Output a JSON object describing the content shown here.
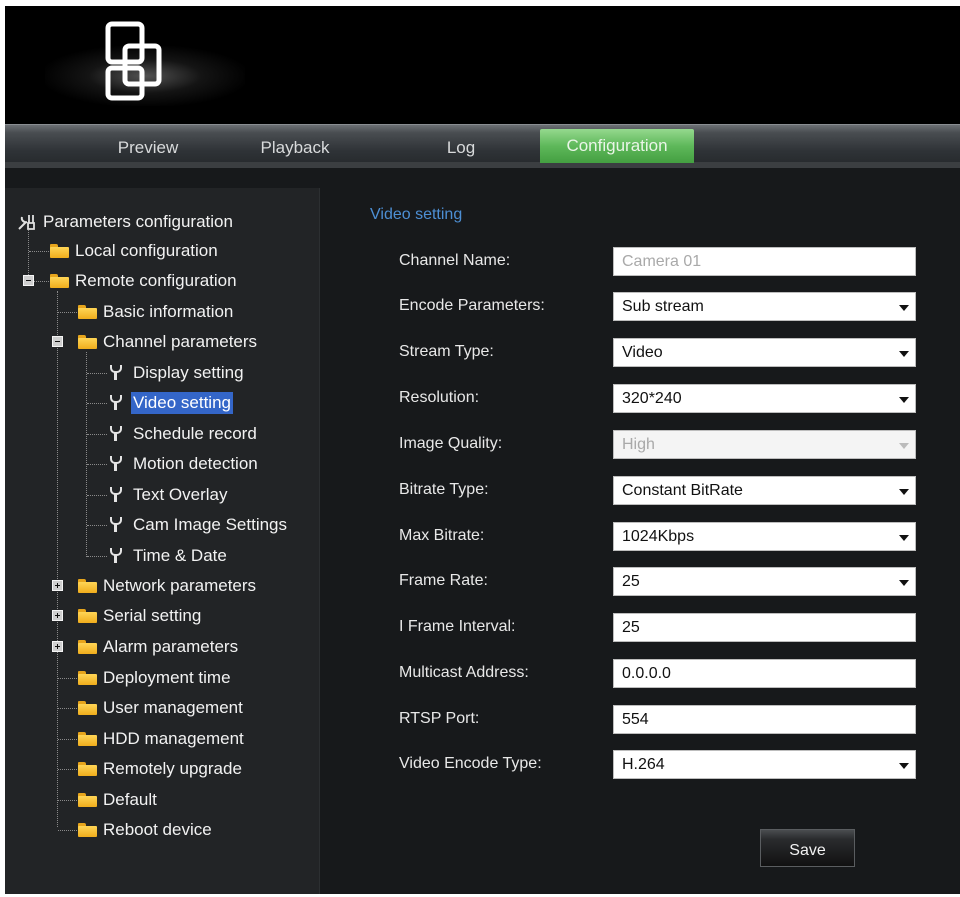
{
  "nav": {
    "tabs": [
      {
        "label": "Preview"
      },
      {
        "label": "Playback"
      },
      {
        "label": "Log"
      },
      {
        "label": "Configuration"
      }
    ],
    "active_tab": "Configuration",
    "active_color": "#5eb85a"
  },
  "sidebar": {
    "root": "Parameters configuration",
    "items": {
      "local": "Local configuration",
      "remote": "Remote configuration",
      "basic": "Basic information",
      "channel": "Channel parameters",
      "display": "Display setting",
      "video": "Video setting",
      "schedule": "Schedule record",
      "motion": "Motion detection",
      "text_overlay": "Text Overlay",
      "cam_image": "Cam Image Settings",
      "time_date": "Time & Date",
      "network": "Network parameters",
      "serial": "Serial setting",
      "alarm": "Alarm parameters",
      "deployment": "Deployment time",
      "user_mgmt": "User management",
      "hdd_mgmt": "HDD management",
      "upgrade": "Remotely upgrade",
      "default": "Default",
      "reboot": "Reboot device"
    },
    "selected": "Video setting",
    "selected_color": "#3466c8"
  },
  "form": {
    "title": "Video setting",
    "title_color": "#4d8fd4",
    "fields": {
      "channel_name": {
        "label": "Channel Name:",
        "value": "Camera 01"
      },
      "encode_parameters": {
        "label": "Encode Parameters:",
        "value": "Sub stream"
      },
      "stream_type": {
        "label": "Stream Type:",
        "value": "Video"
      },
      "resolution": {
        "label": "Resolution:",
        "value": "320*240"
      },
      "image_quality": {
        "label": "Image Quality:",
        "value": "High"
      },
      "bitrate_type": {
        "label": "Bitrate Type:",
        "value": "Constant BitRate"
      },
      "max_bitrate": {
        "label": "Max Bitrate:",
        "value": "1024Kbps"
      },
      "frame_rate": {
        "label": "Frame Rate:",
        "value": "25"
      },
      "i_frame_interval": {
        "label": "I Frame Interval:",
        "value": "25"
      },
      "multicast_address": {
        "label": "Multicast Address:",
        "value": "0.0.0.0"
      },
      "rtsp_port": {
        "label": "RTSP Port:",
        "value": "554"
      },
      "video_encode_type": {
        "label": "Video Encode Type:",
        "value": "H.264"
      }
    },
    "save_label": "Save"
  },
  "icons": {
    "logo": "logo-icon",
    "root": "tools-icon",
    "folder": "folder-icon",
    "leaf": "wrench-icon",
    "dropdown": "chevron-down-icon",
    "expander": "plus-minus-icon"
  }
}
